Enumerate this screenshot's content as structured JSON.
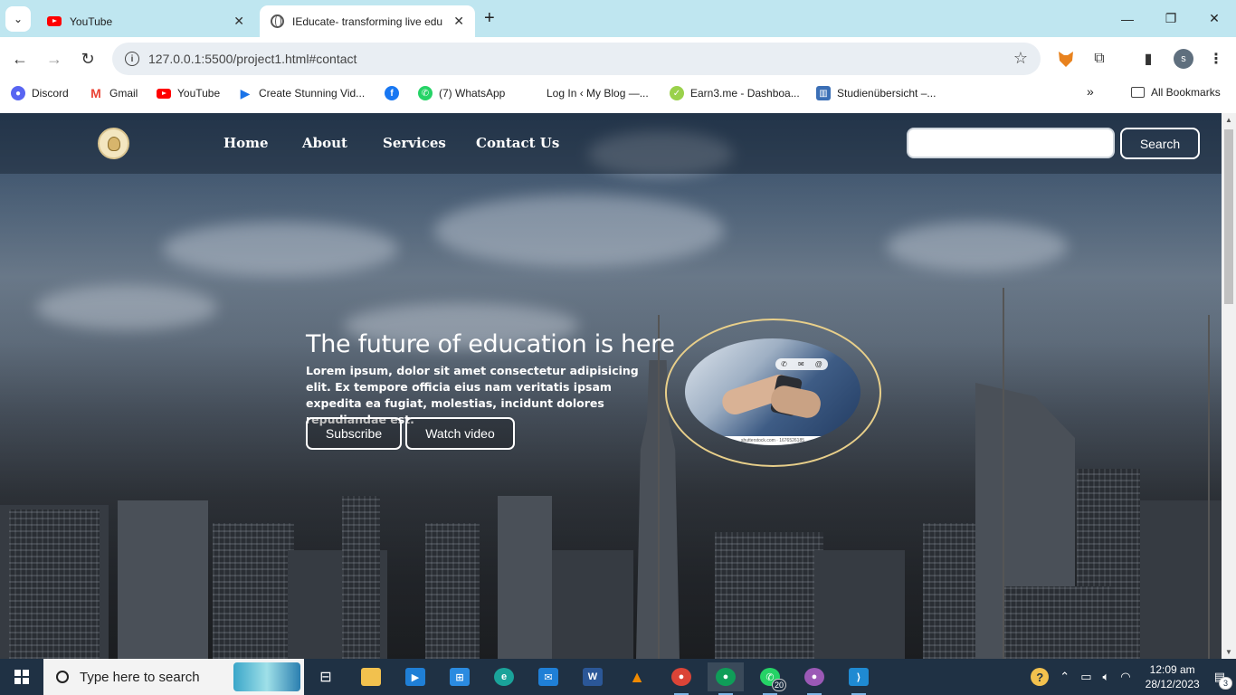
{
  "browser": {
    "tabs": [
      {
        "label": "YouTube",
        "active": false,
        "icon": "youtube-icon"
      },
      {
        "label": "IEducate- transforming live edu",
        "active": true,
        "icon": "globe-icon"
      }
    ],
    "address": "127.0.0.1:5500/project1.html#contact",
    "bookmarks": [
      {
        "label": "Discord",
        "icon": "discord-icon",
        "color": "#5865f2"
      },
      {
        "label": "Gmail",
        "icon": "gmail-icon",
        "color": "#ea4335"
      },
      {
        "label": "YouTube",
        "icon": "youtube-icon",
        "color": "#ff0000"
      },
      {
        "label": "Create Stunning Vid...",
        "icon": "video-icon",
        "color": "#1a73e8"
      },
      {
        "label": "",
        "icon": "facebook-icon",
        "color": "#1877f2"
      },
      {
        "label": "(7) WhatsApp",
        "icon": "whatsapp-icon",
        "color": "#25d366"
      },
      {
        "label": "Log In ‹ My Blog —...",
        "icon": "",
        "color": "#ffffff"
      },
      {
        "label": "Earn3.me - Dashboa...",
        "icon": "earn3-icon",
        "color": "#9ad14b"
      },
      {
        "label": "Studienübersicht –...",
        "icon": "studies-icon",
        "color": "#3b6fb6"
      }
    ],
    "all_bookmarks_label": "All Bookmarks",
    "profile_initial": "s"
  },
  "site": {
    "nav": [
      "Home",
      "About",
      "Services",
      "Contact Us"
    ],
    "search_button": "Search",
    "search_value": "",
    "hero": {
      "title": "The future of education is here",
      "text": "Lorem ipsum, dolor sit amet consectetur adipisicing elit. Ex tempore officia eius nam veritatis ipsam expedita ea fugiat, molestias, incidunt dolores repudiandae est.",
      "subscribe": "Subscribe",
      "watch": "Watch video"
    },
    "image_caption": "shutterstock.com · 1676526185",
    "accent_color": "#e8cf8a"
  },
  "taskbar": {
    "search_placeholder": "Type here to search",
    "whatsapp_badge": "20",
    "time": "12:09 am",
    "date": "28/12/2023",
    "notification_count": "3"
  }
}
